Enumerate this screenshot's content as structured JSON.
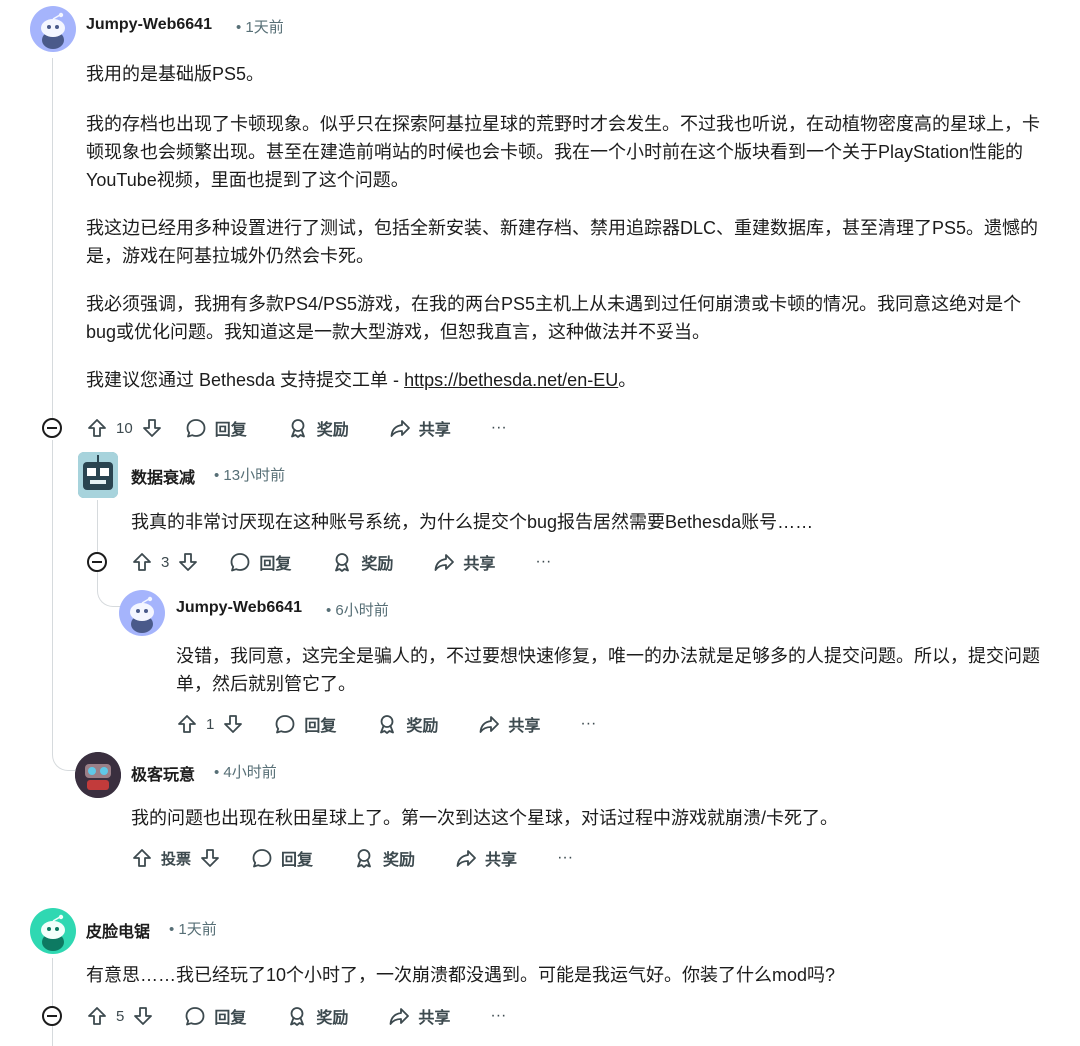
{
  "comments": [
    {
      "author": "Jumpy-Web6641",
      "time": "• 1天前",
      "paragraphs": [
        "我用的是基础版PS5。",
        "我的存档也出现了卡顿现象。似乎只在探索阿基拉星球的荒野时才会发生。不过我也听说，在动植物密度高的星球上，卡顿现象也会频繁出现。甚至在建造前哨站的时候也会卡顿。我在一个小时前在这个版块看到一个关于PlayStation性能的YouTube视频，里面也提到了这个问题。",
        "我这边已经用多种设置进行了测试，包括全新安装、新建存档、禁用追踪器DLC、重建数据库，甚至清理了PS5。遗憾的是，游戏在阿基拉城外仍然会卡死。",
        "我必须强调，我拥有多款PS4/PS5游戏，在我的两台PS5主机上从未遇到过任何崩溃或卡顿的情况。我同意这绝对是个bug或优化问题。我知道这是一款大型游戏，但恕我直言，这种做法并不妥当。"
      ],
      "last_prefix": "我建议您通过 Bethesda 支持提交工单 - ",
      "link": "https://bethesda.net/en-EU",
      "last_suffix": "。",
      "votes": "10"
    },
    {
      "author": "数据衰减",
      "time": "• 13小时前",
      "text": "我真的非常讨厌现在这种账号系统，为什么提交个bug报告居然需要Bethesda账号……",
      "votes": "3"
    },
    {
      "author": "Jumpy-Web6641",
      "time": "• 6小时前",
      "text": "没错，我同意，这完全是骗人的，不过要想快速修复，唯一的办法就是足够多的人提交问题。所以，提交问题单，然后就别管它了。",
      "votes": "1"
    },
    {
      "author": "极客玩意",
      "time": "• 4小时前",
      "text": "我的问题也出现在秋田星球上了。第一次到达这个星球，对话过程中游戏就崩溃/卡死了。",
      "votes": "投票"
    },
    {
      "author": "皮脸电锯",
      "time": "• 1天前",
      "text": "有意思……我已经玩了10个小时了，一次崩溃都没遇到。可能是我运气好。你装了什么mod吗?",
      "votes": "5"
    }
  ],
  "actions": {
    "reply": "回复",
    "award": "奖励",
    "share": "共享",
    "more": "···"
  },
  "colors": {
    "avatar_purple": "#a5b4fc",
    "avatar_green": "#2fd8b2",
    "thread_line": "#d6dadd"
  }
}
